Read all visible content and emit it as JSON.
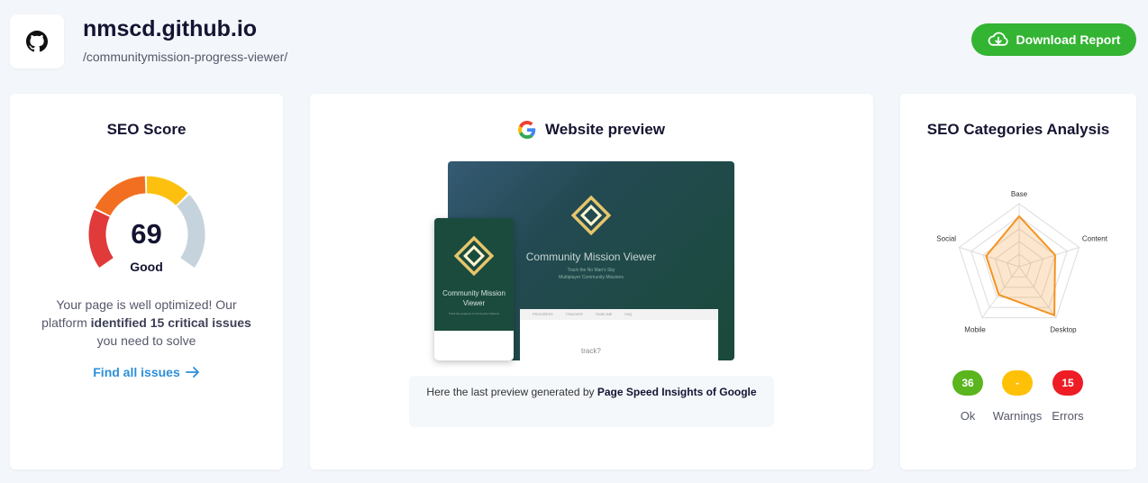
{
  "header": {
    "site_title": "nmscd.github.io",
    "site_path": "/communitymission-progress-viewer/",
    "download_label": "Download Report",
    "logo_icon": "github-icon"
  },
  "score_card": {
    "title": "SEO Score",
    "score": "69",
    "rating": "Good",
    "desc_pre": "Your page is well optimized! Our platform",
    "desc_bold": "identified 15 critical issues",
    "desc_post": "you need to solve",
    "link_label": "Find all issues",
    "colors": {
      "red": "#e03a3a",
      "orange": "#f26f21",
      "yellow": "#fdc00f",
      "gray": "#c5d3dc"
    }
  },
  "preview_card": {
    "title": "Website preview",
    "desktop_title": "Community Mission Viewer",
    "desktop_sub1": "Track the No Man's Sky",
    "desktop_sub2": "Multiplayer Community Missions",
    "desktop_tabs": [
      "PROGRESS",
      "TRACKER",
      "TIMELINE",
      "FAQ"
    ],
    "desktop_partial_text": "track?",
    "mobile_title": "Community Mission Viewer",
    "mobile_sub": "Track the progress of community missions",
    "note_pre": "Here the last preview generated by",
    "note_bold": "Page Speed Insights of Google"
  },
  "categories_card": {
    "title": "SEO Categories Analysis",
    "radar_labels": [
      "Base",
      "Content",
      "Desktop",
      "Mobile",
      "Social"
    ],
    "radar_values": [
      0.8,
      0.6,
      0.95,
      0.55,
      0.55
    ],
    "accent": "#f39322",
    "badges": [
      {
        "value": "36",
        "label": "Ok",
        "color": "#5ab51e"
      },
      {
        "value": "-",
        "label": "Warnings",
        "color": "#ffc107"
      },
      {
        "value": "15",
        "label": "Errors",
        "color": "#ee1c25"
      }
    ]
  }
}
